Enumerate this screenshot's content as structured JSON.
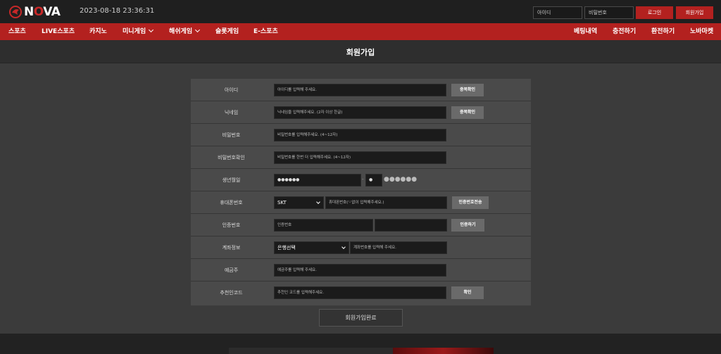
{
  "brand": {
    "name_prefix": "N",
    "name_o": "O",
    "name_suffix": "VA",
    "accent": "#b3211f"
  },
  "header": {
    "datetime": "2023-08-18 23:36:31",
    "id_placeholder": "아이디",
    "pw_placeholder": "비밀번호",
    "login_label": "로그인",
    "join_label": "회원가입"
  },
  "nav": {
    "left": [
      "스포츠",
      "LIVE스포츠",
      "카지노",
      "미니게임",
      "해쉬게임",
      "슬롯게임",
      "E-스포츠"
    ],
    "right": [
      "베팅내역",
      "충전하기",
      "환전하기",
      "노바마켓"
    ]
  },
  "page": {
    "title": "회원가입"
  },
  "form": {
    "rows": [
      {
        "label": "아이디",
        "placeholder": "아이디를 입력해 주세요.",
        "button": "중복확인"
      },
      {
        "label": "닉네임",
        "placeholder": "닉네임을 입력해주세요. (2자 이상 한글)",
        "button": "중복확인"
      },
      {
        "label": "비밀번호",
        "placeholder": "비밀번호를 입력해주세요. (4~12자)"
      },
      {
        "label": "비밀번호확인",
        "placeholder": "비밀번호를 한번 더 입력해주세요. (4~12자)"
      },
      {
        "label": "생년월일",
        "birth_value": "●●●●●●",
        "dash": "-",
        "gender_value": "●",
        "masked": "●●●●●●"
      },
      {
        "label": "휴대폰번호",
        "carrier": "SKT",
        "placeholder": "휴대폰번호('-'없이 입력해주세요.)",
        "button": "인증번호전송"
      },
      {
        "label": "인증번호",
        "placeholder": "인증번호",
        "button": "인증하기"
      },
      {
        "label": "계좌정보",
        "bank": "은행선택",
        "placeholder": "계좌번호를 입력해 주세요."
      },
      {
        "label": "예금주",
        "placeholder": "예금주를 입력해 주세요."
      },
      {
        "label": "추천인코드",
        "placeholder": "추천인 코드를 입력해주세요.",
        "button": "확인"
      }
    ],
    "submit_label": "회원가입완료"
  }
}
